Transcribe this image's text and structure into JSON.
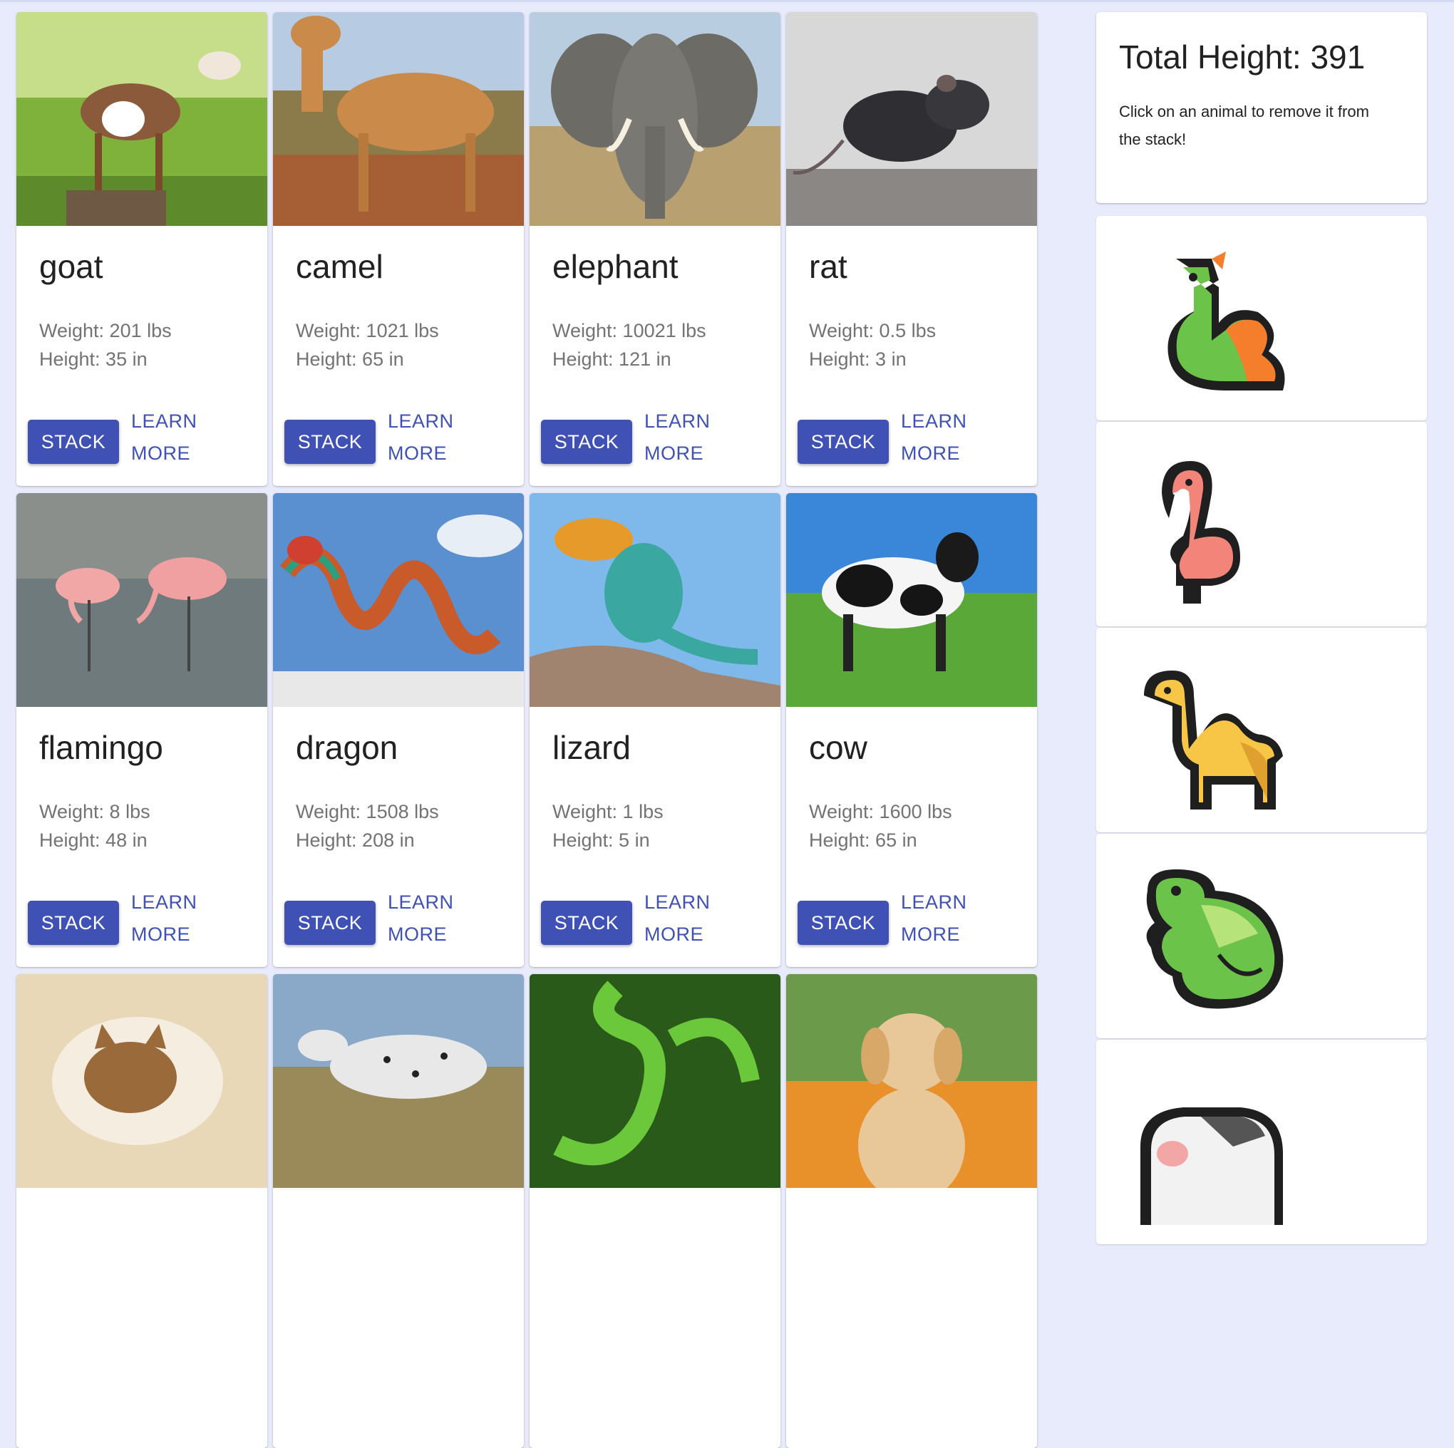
{
  "animals": [
    {
      "name": "goat",
      "weight": "Weight: 201 lbs",
      "height": "Height: 35 in",
      "stack": "STACK",
      "learn1": "LEARN",
      "learn2": "MORE"
    },
    {
      "name": "camel",
      "weight": "Weight: 1021 lbs",
      "height": "Height: 65 in",
      "stack": "STACK",
      "learn1": "LEARN",
      "learn2": "MORE"
    },
    {
      "name": "elephant",
      "weight": "Weight: 10021 lbs",
      "height": "Height: 121 in",
      "stack": "STACK",
      "learn1": "LEARN",
      "learn2": "MORE"
    },
    {
      "name": "rat",
      "weight": "Weight: 0.5 lbs",
      "height": "Height: 3 in",
      "stack": "STACK",
      "learn1": "LEARN",
      "learn2": "MORE"
    },
    {
      "name": "flamingo",
      "weight": "Weight: 8 lbs",
      "height": "Height: 48 in",
      "stack": "STACK",
      "learn1": "LEARN",
      "learn2": "MORE"
    },
    {
      "name": "dragon",
      "weight": "Weight: 1508 lbs",
      "height": "Height: 208 in",
      "stack": "STACK",
      "learn1": "LEARN",
      "learn2": "MORE"
    },
    {
      "name": "lizard",
      "weight": "Weight: 1 lbs",
      "height": "Height: 5 in",
      "stack": "STACK",
      "learn1": "LEARN",
      "learn2": "MORE"
    },
    {
      "name": "cow",
      "weight": "Weight: 1600 lbs",
      "height": "Height: 65 in",
      "stack": "STACK",
      "learn1": "LEARN",
      "learn2": "MORE"
    }
  ],
  "sidebar": {
    "total_height": "Total Height: 391",
    "hint": "Click on an animal to remove it from the stack!",
    "stack_icons": [
      "dragon-icon",
      "flamingo-icon",
      "camel-icon",
      "lizard-icon",
      "cow-icon"
    ]
  },
  "colors": {
    "accent": "#3f51b5",
    "background": "#e8ebfb"
  }
}
